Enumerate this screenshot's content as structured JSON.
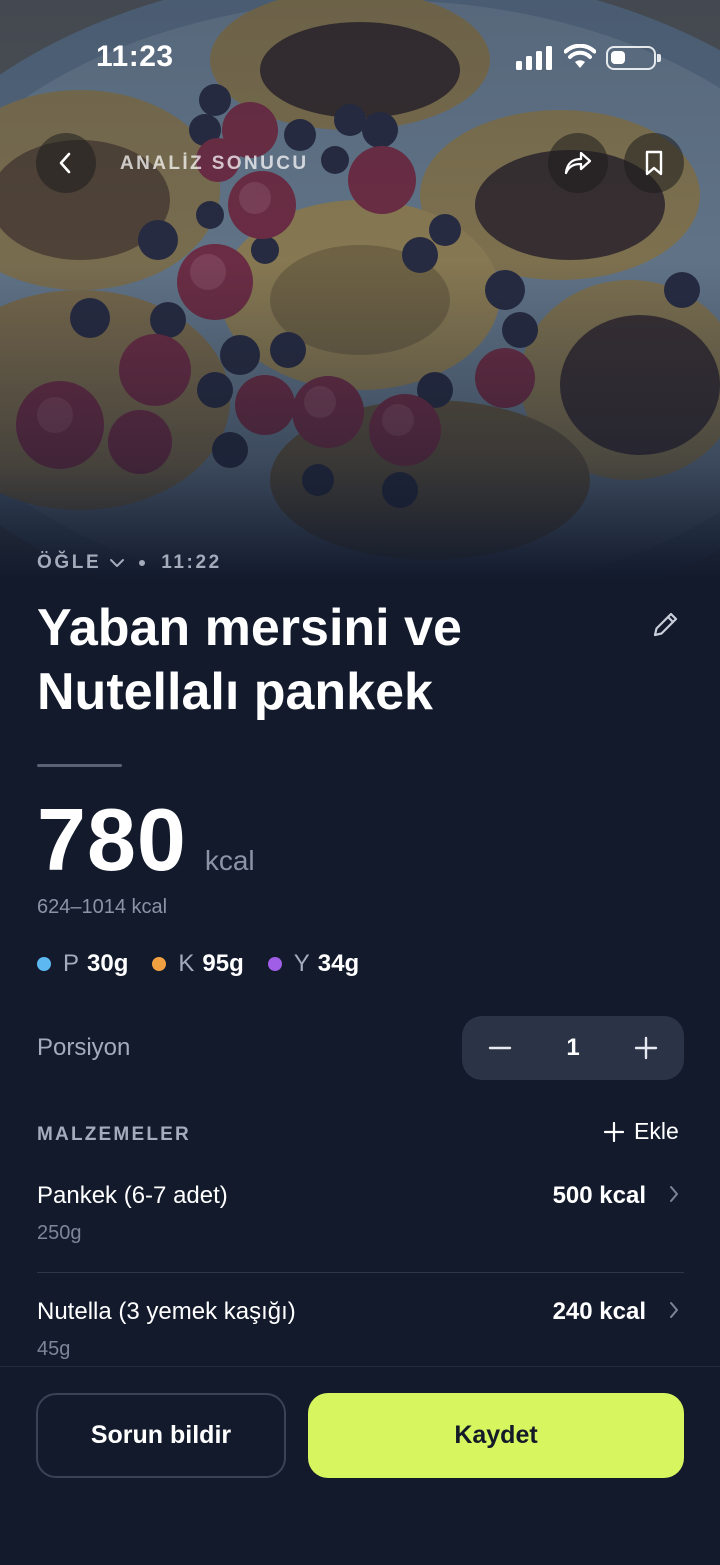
{
  "status_bar": {
    "time": "11:23",
    "battery_level": 0.35
  },
  "nav": {
    "title": "ANALİZ SONUCU",
    "back_icon": "chevron-left-icon",
    "share_icon": "share-arrow-icon",
    "bookmark_icon": "bookmark-icon"
  },
  "meal": {
    "type": "ÖĞLE",
    "time": "11:22",
    "title": "Yaban mersini ve Nutellalı pankek"
  },
  "calories": {
    "value": "780",
    "unit": "kcal",
    "range": "624–1014 kcal"
  },
  "macros": [
    {
      "label": "P",
      "value": "30g",
      "color": "#5db8f2"
    },
    {
      "label": "K",
      "value": "95g",
      "color": "#f0a040"
    },
    {
      "label": "Y",
      "value": "34g",
      "color": "#a05ee6"
    }
  ],
  "portion": {
    "label": "Porsiyon",
    "value": "1"
  },
  "ingredients_section": {
    "heading": "MALZEMELER",
    "add_label": "Ekle"
  },
  "ingredients": [
    {
      "name": "Pankek (6-7 adet)",
      "weight": "250g",
      "kcal": "500 kcal"
    },
    {
      "name": "Nutella (3 yemek kaşığı)",
      "weight": "45g",
      "kcal": "240 kcal"
    }
  ],
  "actions": {
    "report": "Sorun bildir",
    "save": "Kaydet"
  },
  "colors": {
    "background": "#121a2c",
    "accent": "#d6f55e"
  }
}
